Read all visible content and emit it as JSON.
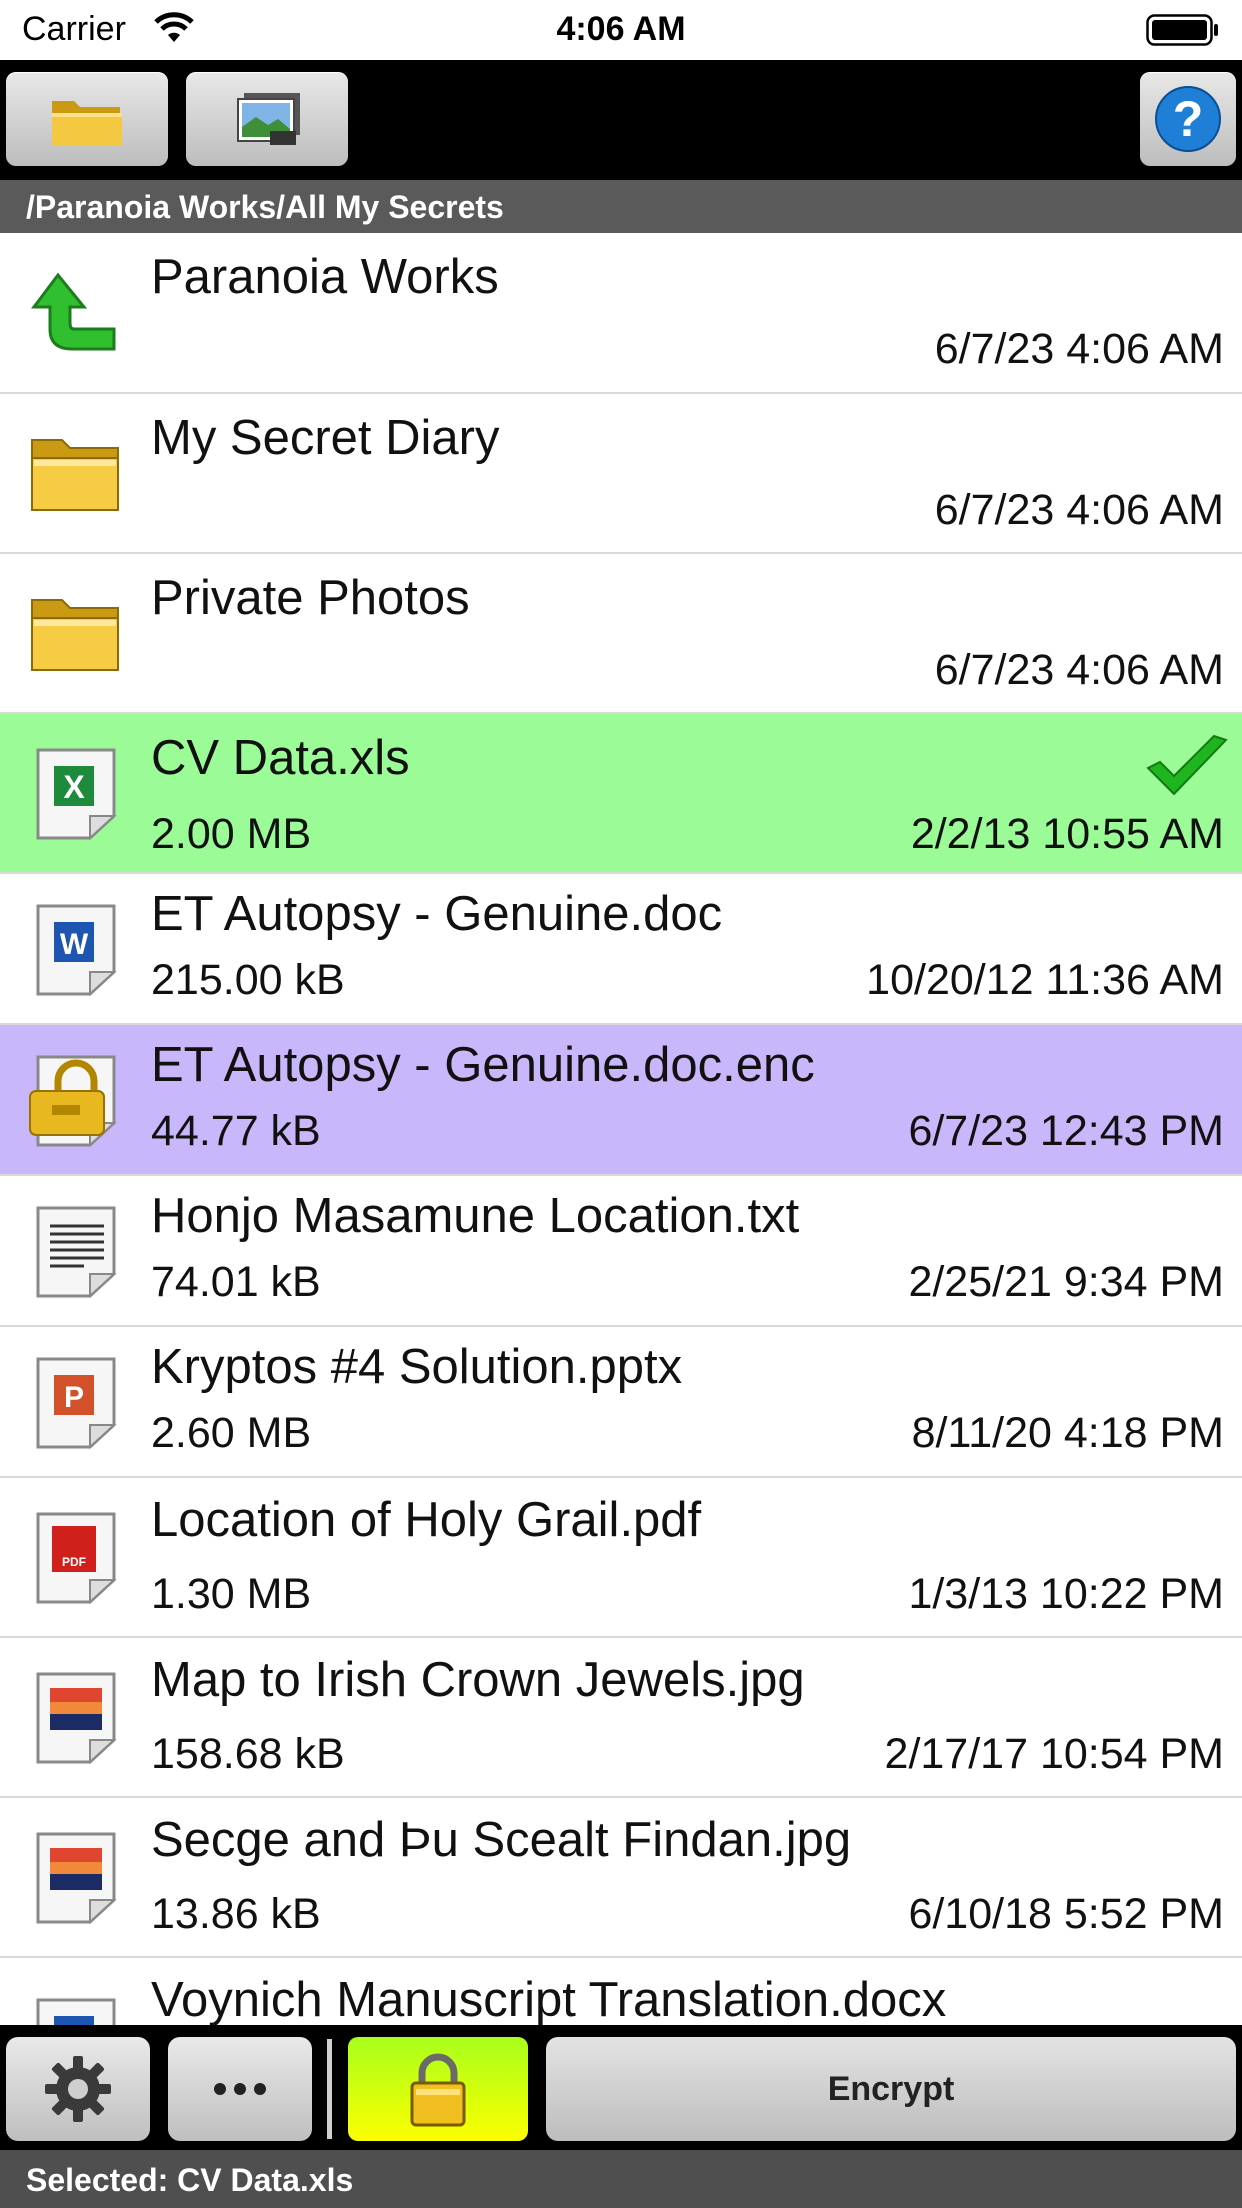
{
  "status_bar": {
    "carrier": "Carrier",
    "time": "4:06 AM"
  },
  "toolbar": {
    "folder_icon": "folder-icon",
    "photos_icon": "photos-icon",
    "help_icon": "help-icon"
  },
  "path": "/Paranoia Works/All My Secrets",
  "colors": {
    "selected_row": "#9bfb96",
    "encrypted_row": "#c8b7fb",
    "lock_button": "#fcff00"
  },
  "rows": [
    {
      "name": "Paranoia Works",
      "size": "",
      "date": "6/7/23 4:06 AM",
      "icon": "up-arrow-icon"
    },
    {
      "name": "My Secret Diary",
      "size": "",
      "date": "6/7/23 4:06 AM",
      "icon": "folder-icon"
    },
    {
      "name": "Private Photos",
      "size": "",
      "date": "6/7/23 4:06 AM",
      "icon": "folder-icon"
    },
    {
      "name": "CV Data.xls",
      "size": "2.00 MB",
      "date": "2/2/13 10:55 AM",
      "icon": "excel-file-icon",
      "selected": true
    },
    {
      "name": "ET Autopsy - Genuine.doc",
      "size": "215.00 kB",
      "date": "10/20/12 11:36 AM",
      "icon": "word-file-icon"
    },
    {
      "name": "ET Autopsy - Genuine.doc.enc",
      "size": "44.77 kB",
      "date": "6/7/23 12:43 PM",
      "icon": "encrypted-file-icon",
      "encrypted": true
    },
    {
      "name": "Honjo Masamune Location.txt",
      "size": "74.01 kB",
      "date": "2/25/21 9:34 PM",
      "icon": "text-file-icon"
    },
    {
      "name": "Kryptos #4 Solution.pptx",
      "size": "2.60 MB",
      "date": "8/11/20 4:18 PM",
      "icon": "powerpoint-file-icon"
    },
    {
      "name": "Location of Holy Grail.pdf",
      "size": "1.30 MB",
      "date": "1/3/13 10:22 PM",
      "icon": "pdf-file-icon"
    },
    {
      "name": "Map to Irish Crown Jewels.jpg",
      "size": "158.68 kB",
      "date": "2/17/17 10:54 PM",
      "icon": "image-file-icon"
    },
    {
      "name": "Secge and Þu Scealt Findan.jpg",
      "size": "13.86 kB",
      "date": "6/10/18 5:52 PM",
      "icon": "image-file-icon"
    },
    {
      "name": "Voynich Manuscript Translation.docx",
      "size": "",
      "date": "",
      "icon": "word-file-icon"
    }
  ],
  "bottom_bar": {
    "settings_icon": "gear-icon",
    "more_icon": "more-icon",
    "lock_icon": "lock-icon",
    "encrypt_label": "Encrypt"
  },
  "footer": {
    "selected_text": "Selected: CV Data.xls"
  }
}
